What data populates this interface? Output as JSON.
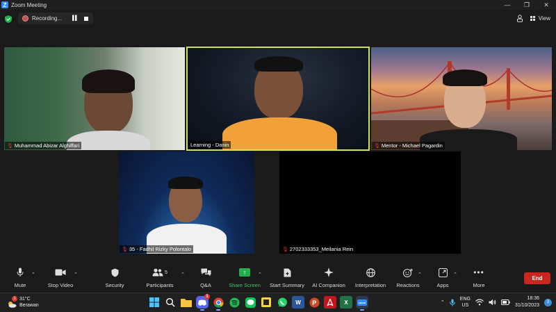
{
  "window": {
    "title": "Zoom Meeting",
    "controls": [
      "—",
      "❐",
      "✕"
    ]
  },
  "topbar": {
    "recording_label": "Recording...",
    "view_label": "View",
    "colors": {
      "security_green": "#23b14d",
      "active_border": "#c9e262"
    }
  },
  "participants": [
    {
      "name": "Muhammad Abizar Alghiffari",
      "muted": true
    },
    {
      "name": "Learning - Danin",
      "muted": false,
      "active_speaker": true
    },
    {
      "name": "Mentor - Michael Pagardin",
      "muted": true
    },
    {
      "name": "35 - Fadhil Rizky Polontalo",
      "muted": true
    },
    {
      "name": "2702333353_Meilania Rein",
      "muted": true,
      "video_off": true
    }
  ],
  "toolbar": {
    "mute": "Mute",
    "stop_video": "Stop Video",
    "security": "Security",
    "participants": "Participants",
    "participants_count": "5",
    "qa": "Q&A",
    "share_screen": "Share Screen",
    "start_summary": "Start Summary",
    "ai_companion": "AI Companion",
    "interpretation": "Interpretation",
    "reactions": "Reactions",
    "apps": "Apps",
    "more": "More",
    "end": "End"
  },
  "taskbar": {
    "weather_temp": "31°C",
    "weather_desc": "Berawan",
    "weather_badge": "1",
    "discord_badge": "1",
    "lang_line1": "ENG",
    "lang_line2": "US",
    "time": "18:36",
    "date": "31/10/2023",
    "notification_count": "3"
  }
}
